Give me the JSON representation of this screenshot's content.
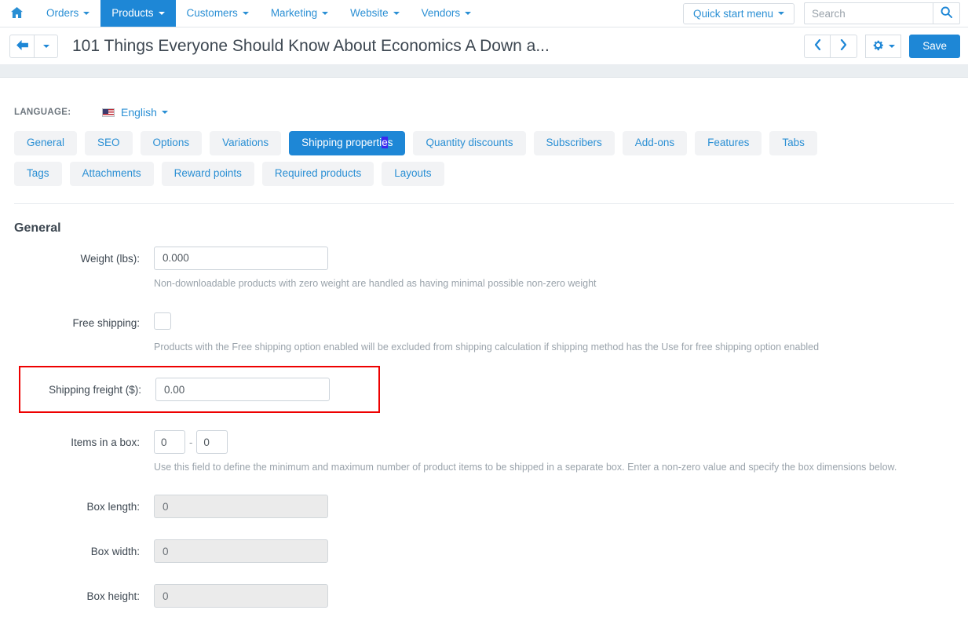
{
  "topnav": {
    "home_icon": "home-icon",
    "items": [
      {
        "label": "Orders",
        "has_caret": true,
        "active": false
      },
      {
        "label": "Products",
        "has_caret": true,
        "active": true
      },
      {
        "label": "Customers",
        "has_caret": true,
        "active": false
      },
      {
        "label": "Marketing",
        "has_caret": true,
        "active": false
      },
      {
        "label": "Website",
        "has_caret": true,
        "active": false
      },
      {
        "label": "Vendors",
        "has_caret": true,
        "active": false
      }
    ],
    "quick_start_label": "Quick start menu",
    "search_placeholder": "Search",
    "search_value": "",
    "search_icon": "search-icon"
  },
  "titlebar": {
    "back_icon": "arrow-left-icon",
    "back_caret_icon": "caret-down-icon",
    "title": "101 Things Everyone Should Know About Economics A Down a...",
    "prev_icon": "chevron-left-icon",
    "next_icon": "chevron-right-icon",
    "gear_icon": "gear-icon",
    "gear_caret_icon": "caret-down-icon",
    "save_label": "Save"
  },
  "language": {
    "label": "LANGUAGE:",
    "flag_icon": "us-flag-icon",
    "value": "English",
    "caret_icon": "caret-down-icon"
  },
  "tabs": [
    {
      "label": "General",
      "active": false
    },
    {
      "label": "SEO",
      "active": false
    },
    {
      "label": "Options",
      "active": false
    },
    {
      "label": "Variations",
      "active": false
    },
    {
      "label": "Shipping properties",
      "active": true,
      "selected_fragment": "e"
    },
    {
      "label": "Quantity discounts",
      "active": false
    },
    {
      "label": "Subscribers",
      "active": false
    },
    {
      "label": "Add-ons",
      "active": false
    },
    {
      "label": "Features",
      "active": false
    },
    {
      "label": "Tabs",
      "active": false
    },
    {
      "label": "Tags",
      "active": false
    },
    {
      "label": "Attachments",
      "active": false
    },
    {
      "label": "Reward points",
      "active": false
    },
    {
      "label": "Required products",
      "active": false
    },
    {
      "label": "Layouts",
      "active": false
    }
  ],
  "section": {
    "title": "General"
  },
  "form": {
    "weight": {
      "label": "Weight (lbs):",
      "value": "0.000",
      "help": "Non-downloadable products with zero weight are handled as having minimal possible non-zero weight"
    },
    "free_shipping": {
      "label": "Free shipping:",
      "checked": false,
      "help": "Products with the Free shipping option enabled will be excluded from shipping calculation if shipping method has the Use for free shipping option enabled"
    },
    "shipping_freight": {
      "label": "Shipping freight ($):",
      "value": "0.00",
      "highlight_color": "#ee0000"
    },
    "items_in_box": {
      "label": "Items in a box:",
      "min_value": "0",
      "max_value": "0",
      "separator": "-",
      "help": "Use this field to define the minimum and maximum number of product items to be shipped in a separate box. Enter a non-zero value and specify the box dimensions below."
    },
    "box_length": {
      "label": "Box length:",
      "value": "0",
      "disabled": true
    },
    "box_width": {
      "label": "Box width:",
      "value": "0",
      "disabled": true
    },
    "box_height": {
      "label": "Box height:",
      "value": "0",
      "disabled": true
    }
  },
  "colors": {
    "accent": "#1e87d6",
    "link": "#2a8fd4",
    "highlight": "#ee0000",
    "band": "#eaeef1"
  }
}
